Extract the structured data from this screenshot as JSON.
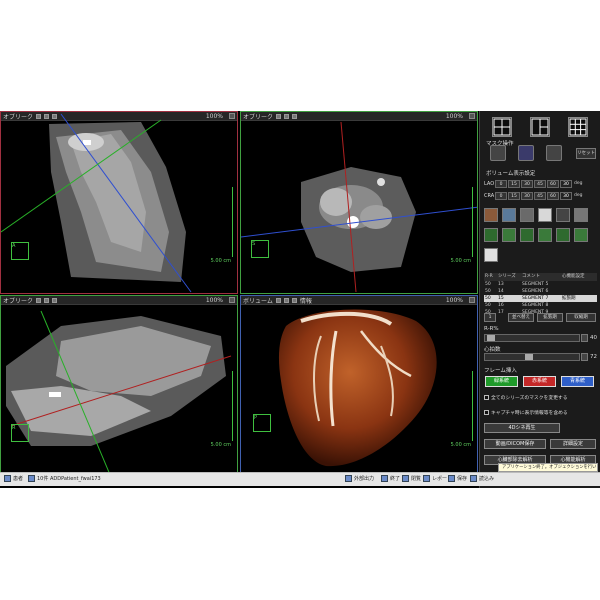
{
  "viewports": [
    {
      "title": "オブリーク",
      "zoom": "100%",
      "scale": "5.00 cm",
      "border": "#a03040",
      "cube": "A"
    },
    {
      "title": "オブリーク",
      "zoom": "100%",
      "scale": "5.00 cm",
      "border": "#40a040",
      "cube": "S"
    },
    {
      "title": "オブリーク",
      "zoom": "100%",
      "scale": "5.00 cm",
      "border": "#40a040",
      "cube": "R"
    },
    {
      "title": "ボリューム",
      "zoom": "100%",
      "extra": "情報",
      "scale": "5.00 cm",
      "border": "#4060b0",
      "cube": "P"
    }
  ],
  "panel": {
    "mask_label": "マスク操作",
    "reset_label": "リセット",
    "volume_label": "ボリューム表示設定",
    "angle_rows": [
      {
        "label": "LAO",
        "values": [
          "0",
          "15",
          "30",
          "45",
          "60"
        ],
        "active": "30",
        "unit": "deg"
      },
      {
        "label": "CRA",
        "values": [
          "0",
          "15",
          "30",
          "45",
          "60"
        ],
        "active": "30",
        "unit": "deg"
      }
    ],
    "series_headers": [
      "R-R",
      "シリーズ",
      "コメント",
      "心機能設定"
    ],
    "series_rows": [
      {
        "rr": "50",
        "series": "13",
        "comment": "SEGMENT 5",
        "func": ""
      },
      {
        "rr": "50",
        "series": "14",
        "comment": "SEGMENT 6",
        "func": ""
      },
      {
        "rr": "50",
        "series": "15",
        "comment": "SEGMENT 7",
        "func": "拡張期",
        "selected": true
      },
      {
        "rr": "50",
        "series": "16",
        "comment": "SEGMENT 8",
        "func": ""
      },
      {
        "rr": "50",
        "series": "17",
        "comment": "SEGMENT 9",
        "func": ""
      }
    ],
    "series_buttons": [
      "1",
      "並べ替え",
      "拡張期",
      "収縮期"
    ],
    "rr_label": "R-R%",
    "rr_value": "40",
    "heart_label": "心拍数",
    "heart_value": "72",
    "frame_label": "フレーム挿入",
    "color_buttons": [
      {
        "label": "緑系統",
        "color": "#1f9a2a"
      },
      {
        "label": "赤系統",
        "color": "#c42828"
      },
      {
        "label": "青系統",
        "color": "#2f5fc8"
      }
    ],
    "check1": "全てのシリーズのマスクを変更する",
    "check2": "キャプチャ時に表示情報等を含める",
    "play_button": "4Dシネ再生",
    "save_button": "動画/DICOM保存",
    "detail_button": "詳細設定",
    "auto_button": "心臓部除去解析",
    "func_button": "心機能解析"
  },
  "taskbar": {
    "items": [
      {
        "label": "患者"
      },
      {
        "label": "10件 ADDPatient_fwai173"
      },
      {
        "label": "外部出力"
      },
      {
        "label": "終了"
      },
      {
        "label": "閉覧"
      },
      {
        "label": "レポート"
      },
      {
        "label": "保存"
      },
      {
        "label": "読込み"
      }
    ],
    "notify": "アプリケーション終了。オプジェクションを行いました。"
  },
  "colors": {
    "bone": "#ffffff",
    "tissue": "#808080",
    "green": "#3fbf3f",
    "red": "#b02020",
    "blue": "#3050c0"
  }
}
